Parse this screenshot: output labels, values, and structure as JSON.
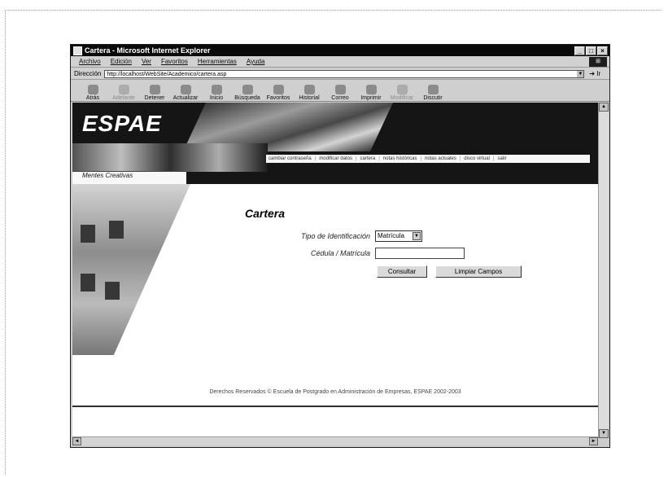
{
  "window": {
    "title": "Cartera - Microsoft Internet Explorer"
  },
  "menu": {
    "items": [
      "Archivo",
      "Edición",
      "Ver",
      "Favoritos",
      "Herramientas",
      "Ayuda"
    ]
  },
  "address": {
    "label": "Dirección",
    "url": "http://localhost/WebSite/Academico/cartera.asp",
    "go_label": "Ir"
  },
  "toolbar": {
    "buttons": [
      "Atrás",
      "Adelante",
      "Detener",
      "Actualizar",
      "Inicio",
      "Búsqueda",
      "Favoritos",
      "Historial",
      "Correo",
      "Imprimir",
      "Modificar",
      "Discutir"
    ]
  },
  "site": {
    "logo": "ESPAE",
    "motto": "Mentes Creativas",
    "nav": [
      "cambiar contraseña",
      "modificar datos",
      "cartera",
      "notas históricas",
      "notas actuales",
      "disco virtual",
      "salir"
    ]
  },
  "form": {
    "title": "Cartera",
    "id_type_label": "Tipo de Identificación",
    "id_type_value": "Matrícula",
    "id_number_label": "Cédula / Matrícula",
    "submit_label": "Consultar",
    "clear_label": "Limpiar Campos"
  },
  "footer": {
    "text": "Derechos Reservados © Escuela de Postgrado en Administración de Empresas, ESPAE 2002-2003"
  }
}
